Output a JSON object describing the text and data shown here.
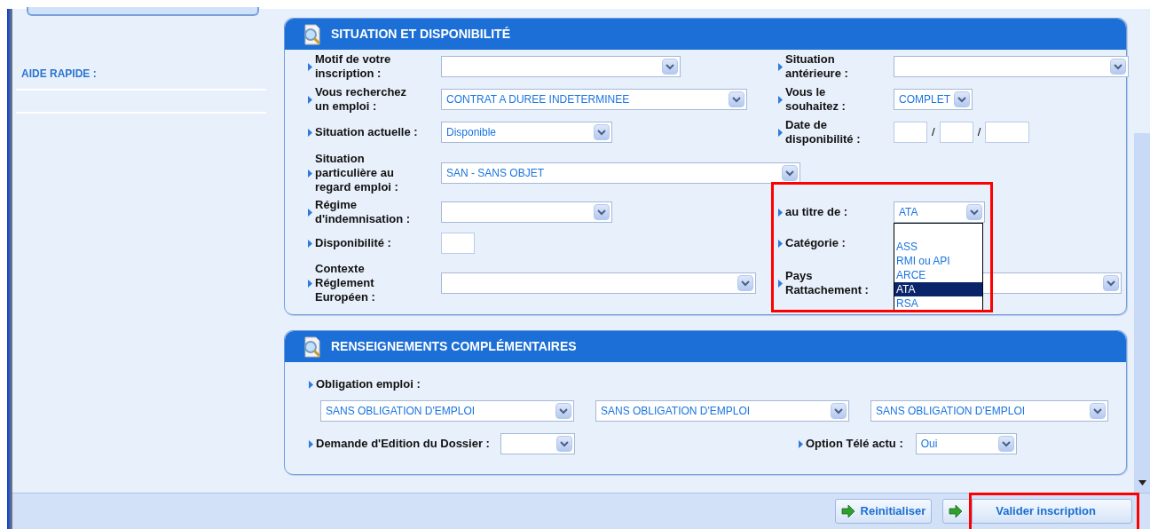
{
  "sidebar": {
    "quick_help_title": "AIDE RAPIDE :"
  },
  "situation": {
    "title": "SITUATION ET DISPONIBILITÉ",
    "rows": [
      {
        "left": {
          "label": "Motif de votre inscription :",
          "kind": "select"
        },
        "right": {
          "label": "Situation antérieure :",
          "kind": "select"
        }
      },
      {
        "left": {
          "label": "Vous recherchez un emploi :",
          "kind": "select",
          "value": "CONTRAT A DUREE INDETERMINEE"
        },
        "right": {
          "label": "Vous le souhaitez :",
          "kind": "select",
          "value": "COMPLET"
        }
      },
      {
        "left": {
          "label": "Situation actuelle :",
          "kind": "select",
          "value": "Disponible"
        },
        "right": {
          "label": "Date de disponibilité :",
          "kind": "date",
          "separators": [
            "/",
            "/"
          ]
        }
      },
      {
        "left": {
          "label": "Situation particulière au regard emploi :",
          "kind": "select",
          "value": "SAN - SANS OBJET"
        }
      },
      {
        "left": {
          "label": "Régime d'indemnisation :",
          "kind": "select"
        },
        "right": {
          "label": "au titre de :",
          "kind": "select",
          "value": "ATA",
          "expanded": true,
          "options": [
            {
              "label": "ASS",
              "selected": false
            },
            {
              "label": "RMI ou API",
              "selected": false
            },
            {
              "label": "ARCE",
              "selected": false
            },
            {
              "label": "ATA",
              "selected": true
            },
            {
              "label": "RSA",
              "selected": false
            }
          ]
        }
      },
      {
        "left": {
          "label": "Disponibilité :",
          "kind": "text"
        },
        "right": {
          "label": "Catégorie :",
          "kind": "label"
        }
      },
      {
        "left": {
          "label": "Contexte Réglement Européen :",
          "kind": "select"
        },
        "right": {
          "label": "Pays Rattachement :",
          "kind": "select"
        }
      }
    ],
    "highlighted": true
  },
  "complements": {
    "title": "RENSEIGNEMENTS COMPLÉMENTAIRES",
    "obligation_label": "Obligation emploi :",
    "obligation_selects": [
      "SANS OBLIGATION D'EMPLOI",
      "SANS OBLIGATION D'EMPLOI",
      "SANS OBLIGATION D'EMPLOI"
    ],
    "edition": {
      "label": "Demande d'Edition du Dossier :"
    },
    "tele_actu": {
      "label": "Option Télé actu :",
      "value": "Oui"
    }
  },
  "buttons": [
    {
      "label": "Reinitialiser",
      "highlighted": false
    },
    {
      "label": "Valider inscription",
      "highlighted": true
    }
  ]
}
